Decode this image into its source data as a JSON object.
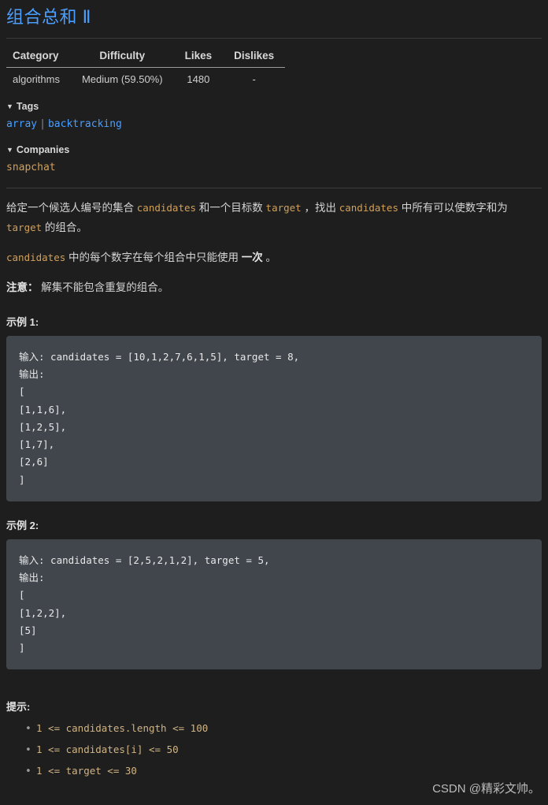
{
  "problem": {
    "title": "组合总和 Ⅱ"
  },
  "meta_table": {
    "headers": [
      "Category",
      "Difficulty",
      "Likes",
      "Dislikes"
    ],
    "row": {
      "category": "algorithms",
      "difficulty": "Medium (59.50%)",
      "likes": "1480",
      "dislikes": "-"
    }
  },
  "tags_section": {
    "caret": "▼",
    "label": "Tags",
    "items": [
      "array",
      "backtracking"
    ],
    "separator": "|",
    "link_color": "#4a9eff"
  },
  "companies_section": {
    "caret": "▼",
    "label": "Companies",
    "items": [
      "snapchat"
    ],
    "link_color": "#d1a05a"
  },
  "description": {
    "p1_a": "给定一个候选人编号的集合 ",
    "p1_code1": "candidates",
    "p1_b": " 和一个目标数 ",
    "p1_code2": "target",
    "p1_c": " ，找出 ",
    "p1_code3": "candidates",
    "p1_d": " 中所有可以使数字和为 ",
    "p1_code4": "target",
    "p1_e": " 的组合。",
    "p2_code1": "candidates",
    "p2_a": " 中的每个数字在每个组合中只能使用 ",
    "p2_bold": "一次",
    "p2_b": " 。",
    "p3_label": "注意：",
    "p3_text": " 解集不能包含重复的组合。"
  },
  "examples": [
    {
      "heading": "示例 1:",
      "code": "输入: candidates = [10,1,2,7,6,1,5], target = 8,\n输出:\n[\n[1,1,6],\n[1,2,5],\n[1,7],\n[2,6]\n]"
    },
    {
      "heading": "示例 2:",
      "code": "输入: candidates = [2,5,2,1,2], target = 5,\n输出:\n[\n[1,2,2],\n[5]\n]"
    }
  ],
  "hints": {
    "heading": "提示:",
    "items": [
      "1 <= candidates.length <= 100",
      "1 <= candidates[i] <= 50",
      "1 <= target <= 30"
    ]
  },
  "watermark": {
    "text": "CSDN @精彩文帅。"
  },
  "theme": {
    "background": "#1e1e1e",
    "code_background": "#41464d",
    "accent_blue": "#4a9eff",
    "accent_gold": "#d1a05a"
  }
}
